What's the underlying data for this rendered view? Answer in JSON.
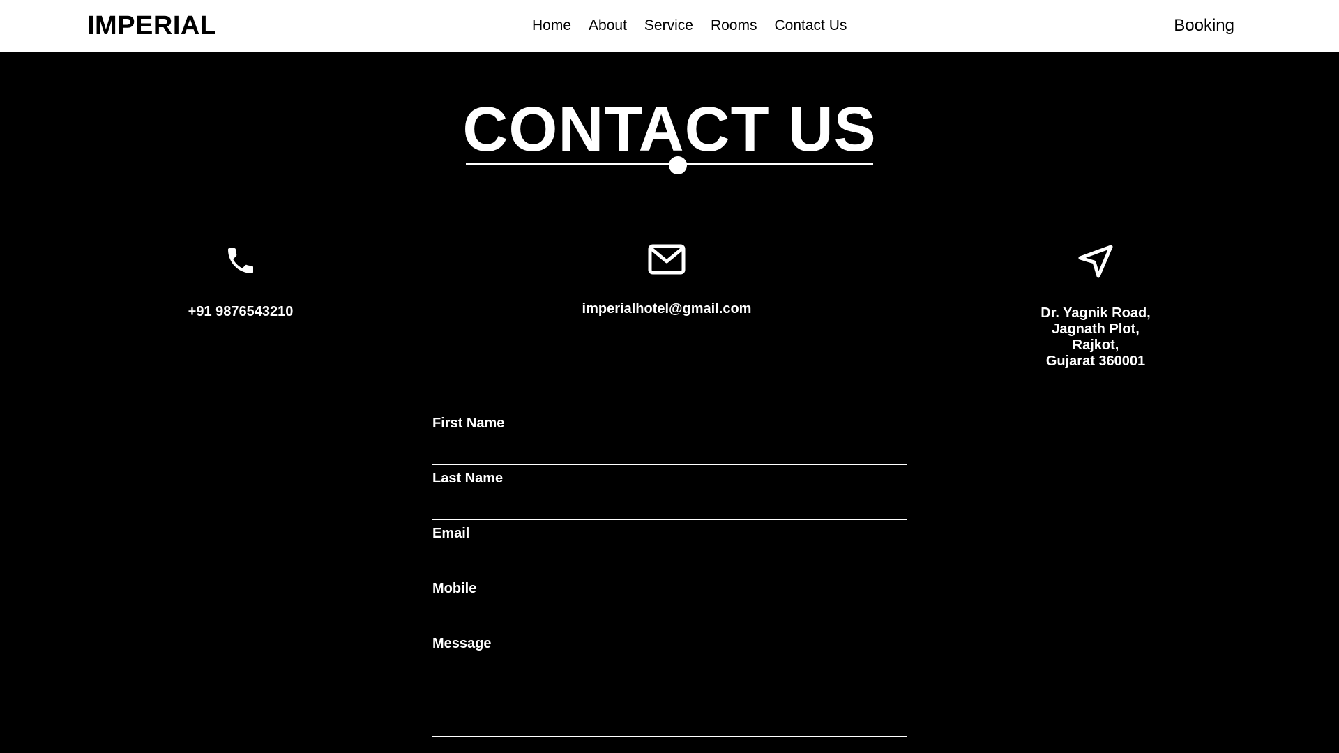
{
  "header": {
    "logo": "IMPERIAL",
    "nav": [
      "Home",
      "About",
      "Service",
      "Rooms",
      "Contact Us"
    ],
    "booking": "Booking"
  },
  "heading": "CONTACT US",
  "contact": {
    "phone_icon": "phone-icon",
    "phone": "+91 9876543210",
    "email_icon": "mail-icon",
    "email": "imperialhotel@gmail.com",
    "address_icon": "location-arrow-icon",
    "address_lines": [
      "Dr. Yagnik Road,",
      "Jagnath Plot,",
      "Rajkot,",
      "Gujarat 360001"
    ]
  },
  "form": {
    "first_name_label": "First Name",
    "first_name_value": "",
    "last_name_label": "Last Name",
    "last_name_value": "",
    "email_label": "Email",
    "email_value": "",
    "mobile_label": "Mobile",
    "mobile_value": "",
    "message_label": "Message",
    "message_value": ""
  },
  "colors": {
    "background": "#000000",
    "navbar": "#ffffff",
    "text_light": "#ffffff",
    "text_dark": "#000000"
  }
}
